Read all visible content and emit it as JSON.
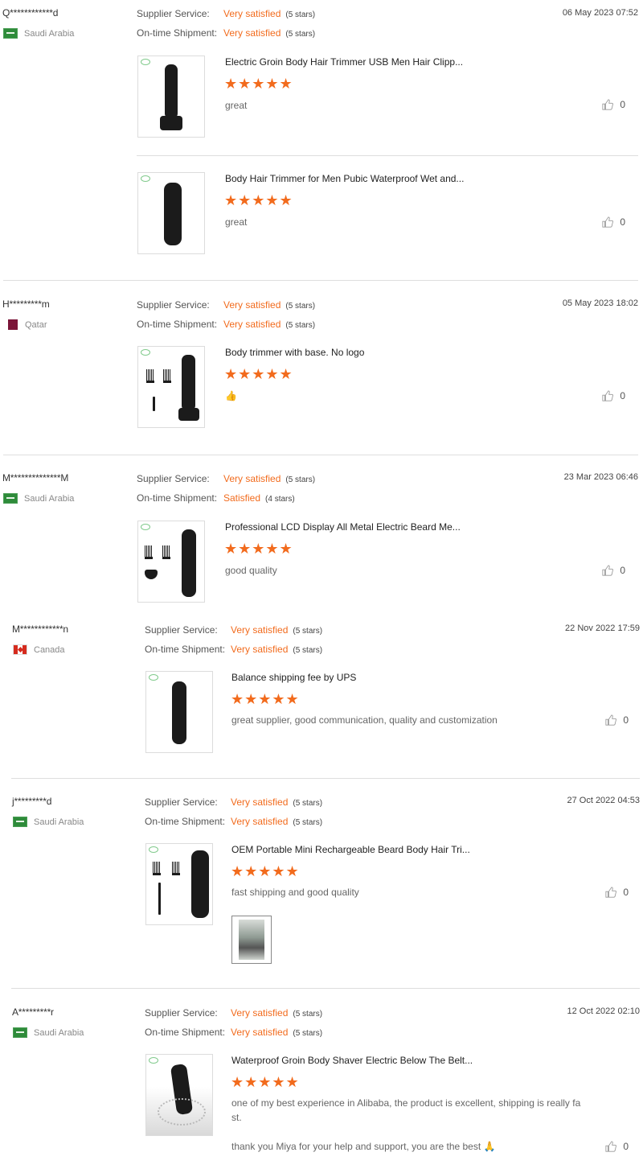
{
  "labels": {
    "supplier_service": "Supplier Service:",
    "ontime_shipment": "On-time Shipment:"
  },
  "accent_color": "#f26b1d",
  "reviews": [
    {
      "reviewer": "Q************d",
      "country": "Saudi Arabia",
      "flag": "saudi-arabia-flag",
      "supplier_service": "Very satisfied",
      "supplier_service_stars": "(5 stars)",
      "ontime_shipment": "Very satisfied",
      "ontime_shipment_stars": "(5 stars)",
      "date": "06 May 2023 07:52",
      "products": [
        {
          "title": "Electric Groin Body Hair Trimmer USB Men Hair Clipp...",
          "stars": "★★★★★",
          "rating": 5,
          "comment": "great",
          "likes": "0"
        },
        {
          "title": "Body Hair Trimmer for Men Pubic Waterproof Wet and...",
          "stars": "★★★★★",
          "rating": 5,
          "comment": "great",
          "likes": "0"
        }
      ]
    },
    {
      "reviewer": "H*********m",
      "country": "Qatar",
      "flag": "qatar-flag",
      "supplier_service": "Very satisfied",
      "supplier_service_stars": "(5 stars)",
      "ontime_shipment": "Very satisfied",
      "ontime_shipment_stars": "(5 stars)",
      "date": "05 May 2023 18:02",
      "products": [
        {
          "title": "Body trimmer with base. No logo",
          "stars": "★★★★★",
          "rating": 5,
          "comment": "👍",
          "likes": "0"
        }
      ]
    },
    {
      "reviewer": "M**************M",
      "country": "Saudi Arabia",
      "flag": "saudi-arabia-flag",
      "supplier_service": "Very satisfied",
      "supplier_service_stars": "(5 stars)",
      "ontime_shipment": "Satisfied",
      "ontime_shipment_stars": "(4 stars)",
      "date": "23 Mar 2023 06:46",
      "products": [
        {
          "title": "Professional LCD Display All Metal Electric Beard Me...",
          "stars": "★★★★★",
          "rating": 5,
          "comment": "good quality",
          "likes": "0"
        }
      ]
    },
    {
      "reviewer": "M************n",
      "country": "Canada",
      "flag": "canada-flag",
      "supplier_service": "Very satisfied",
      "supplier_service_stars": "(5 stars)",
      "ontime_shipment": "Very satisfied",
      "ontime_shipment_stars": "(5 stars)",
      "date": "22 Nov 2022 17:59",
      "products": [
        {
          "title": "Balance shipping fee by UPS",
          "stars": "★★★★★",
          "rating": 5,
          "comment": "great supplier, good communication, quality and customization",
          "likes": "0"
        }
      ]
    },
    {
      "reviewer": "j*********d",
      "country": "Saudi Arabia",
      "flag": "saudi-arabia-flag",
      "supplier_service": "Very satisfied",
      "supplier_service_stars": "(5 stars)",
      "ontime_shipment": "Very satisfied",
      "ontime_shipment_stars": "(5 stars)",
      "date": "27 Oct 2022 04:53",
      "products": [
        {
          "title": "OEM Portable Mini Rechargeable Beard Body Hair Tri...",
          "stars": "★★★★★",
          "rating": 5,
          "comment": "fast shipping and good quality",
          "likes": "0"
        }
      ]
    },
    {
      "reviewer": "A*********r",
      "country": "Saudi Arabia",
      "flag": "saudi-arabia-flag",
      "supplier_service": "Very satisfied",
      "supplier_service_stars": "(5 stars)",
      "ontime_shipment": "Very satisfied",
      "ontime_shipment_stars": "(5 stars)",
      "date": "12 Oct 2022 02:10",
      "products": [
        {
          "title": "Waterproof Groin Body Shaver Electric Below The Belt...",
          "stars": "★★★★★",
          "rating": 5,
          "comment": "one of my best experience in Alibaba, the product is excellent, shipping is really fa",
          "comment_2": "st.",
          "comment_3": "thank you Miya for your help and support, you are the best 🙏",
          "likes": "0"
        }
      ]
    }
  ]
}
